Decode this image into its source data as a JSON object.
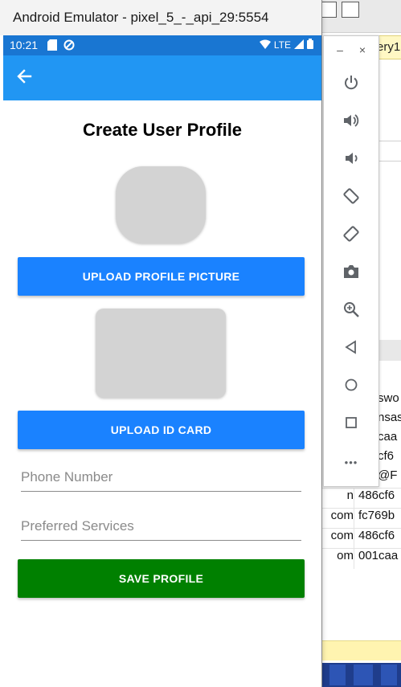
{
  "window": {
    "title": "Android Emulator - pixel_5_-_api_29:5554"
  },
  "status_bar": {
    "time": "10:21",
    "network": "LTE"
  },
  "screen": {
    "title": "Create User Profile",
    "upload_picture_label": "UPLOAD PROFILE PICTURE",
    "upload_id_label": "UPLOAD ID CARD",
    "phone": {
      "placeholder": "Phone Number",
      "value": ""
    },
    "services": {
      "placeholder": "Preferred Services",
      "value": ""
    },
    "save_label": "SAVE PROFILE"
  },
  "emulator_panel": {
    "minimize": "–",
    "close": "×",
    "controls": [
      "power-icon",
      "volume-up-icon",
      "volume-down-icon",
      "rotate-left-icon",
      "rotate-right-icon",
      "camera-icon",
      "zoom-icon",
      "back-icon",
      "home-icon",
      "overview-icon",
      "more-icon"
    ],
    "more_label": "•••"
  },
  "background_app": {
    "tab_text": "ery1",
    "right_cells": [
      "swo",
      "nsas",
      "caa",
      "cf6",
      "@F"
    ],
    "rows": [
      {
        "c1": "n",
        "c2": "486cf6"
      },
      {
        "c1": "com",
        "c2": "fc769b"
      },
      {
        "c1": "com",
        "c2": "486cf6"
      },
      {
        "c1": "om",
        "c2": "001caa"
      }
    ]
  },
  "colors": {
    "status_bar": "#1976d2",
    "app_bar": "#2196f3",
    "primary_button": "#1a82ff",
    "save_button": "#008000",
    "placeholder_box": "#d3d3d3"
  }
}
